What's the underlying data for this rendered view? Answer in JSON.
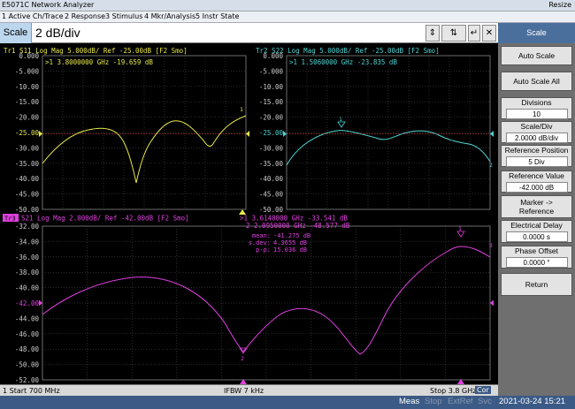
{
  "window": {
    "title": "E5071C Network Analyzer",
    "resize_label": "Resize"
  },
  "menu": [
    "1 Active Ch/Trace",
    "2 Response",
    "3 Stimulus",
    "4 Mkr/Analysis",
    "5 Instr State"
  ],
  "entry": {
    "label": "Scale",
    "value": "2 dB/div"
  },
  "sidebar": {
    "title": "Scale",
    "auto_scale": "Auto Scale",
    "auto_scale_all": "Auto Scale All",
    "divisions_label": "Divisions",
    "divisions_value": "10",
    "scale_div_label": "Scale/Div",
    "scale_div_value": "2.0000 dB/div",
    "ref_pos_label": "Reference Position",
    "ref_pos_value": "5 Div",
    "ref_val_label": "Reference Value",
    "ref_val_value": "-42.000 dB",
    "marker_ref_1": "Marker ->",
    "marker_ref_2": "Reference",
    "elec_delay_label": "Electrical Delay",
    "elec_delay_value": "0.0000 s",
    "phase_off_label": "Phase Offset",
    "phase_off_value": "0.0000 °",
    "return": "Return"
  },
  "trace1": {
    "header": "Tr1 S11 Log Mag 5.000dB/ Ref -25.00dB [F2 Smo]",
    "marker": ">1  3.8000000 GHz -19.659 dB",
    "color": "#e8e84a",
    "yticks": [
      "0.000",
      "-5.000",
      "-10.00",
      "-15.00",
      "-20.00",
      "-25.00",
      "-30.00",
      "-35.00",
      "-40.00",
      "-45.00",
      "-50.00"
    ],
    "ref_label": "-25.00"
  },
  "trace2": {
    "header": "Tr2 S22 Log Mag 5.000dB/ Ref -25.00dB [F2 Smo]",
    "marker": ">1  1.5060000 GHz -23.835 dB",
    "color": "#4fd4d4",
    "yticks": [
      "0.000",
      "-5.000",
      "-10.00",
      "-15.00",
      "-20.00",
      "-25.00",
      "-30.00",
      "-35.00",
      "-40.00",
      "-45.00",
      "-50.00"
    ],
    "ref_label": "-25.00"
  },
  "trace3": {
    "badge": "Tr3",
    "header": "S21 Log Mag 2.000dB/ Ref -42.00dB [F2 Smo]",
    "marker1": ">1  3.6140000 GHz -33.541 dB",
    "marker2": "2  2.0950000 GHz -48.577 dB",
    "stats_labels": [
      "mean:",
      "s.dev:",
      "p-p:"
    ],
    "stats_values": [
      "-41.275 dB",
      "4.3655 dB",
      "15.036 dB"
    ],
    "color": "#e040e0",
    "yticks": [
      "-32.00",
      "-34.00",
      "-36.00",
      "-38.00",
      "-40.00",
      "-42.00",
      "-44.00",
      "-46.00",
      "-48.00",
      "-50.00",
      "-52.00"
    ],
    "ref_label": "-42.00"
  },
  "status": {
    "start": "1  Start 700 MHz",
    "ifbw": "IFBW 7 kHz",
    "stop": "Stop 3.8 GHz",
    "cor": "Cor"
  },
  "bottom": {
    "meas": "Meas",
    "stop": "Stop",
    "extref": "ExtRef",
    "svc": "Svc",
    "datetime": "2021-03-24 15:21"
  }
}
